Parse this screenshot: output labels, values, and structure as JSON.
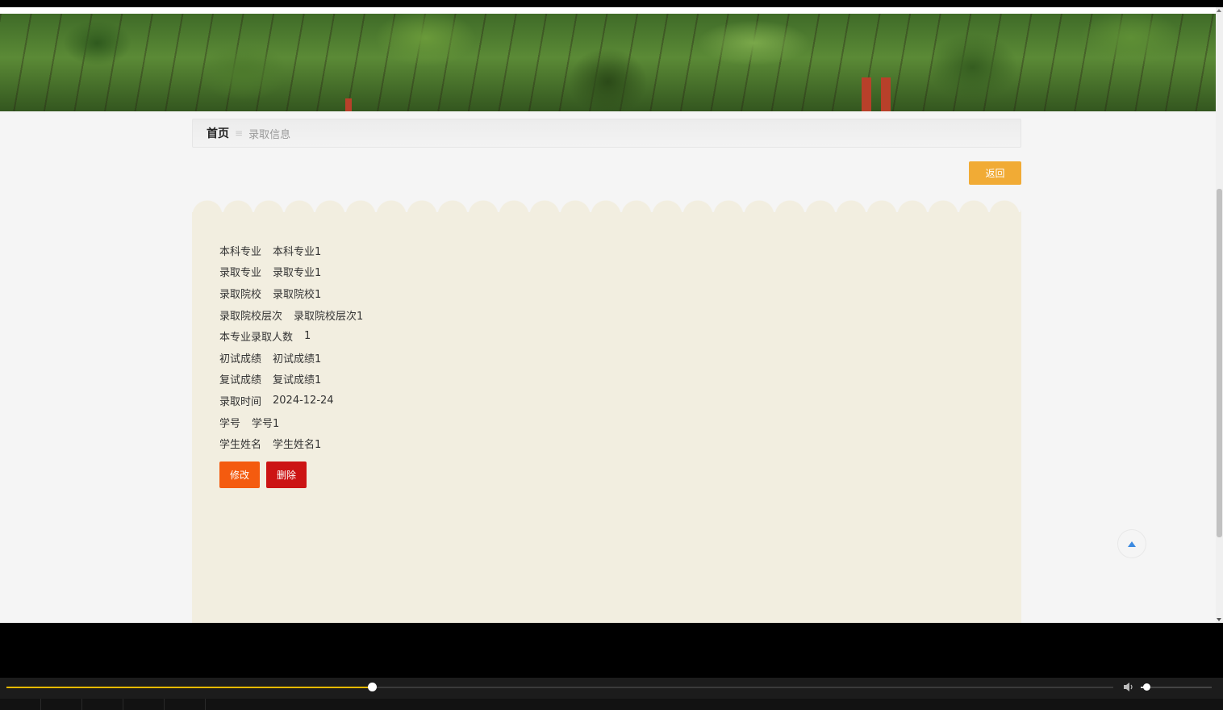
{
  "breadcrumb": {
    "home": "首页",
    "separator": "≡",
    "current": "录取信息"
  },
  "actions": {
    "back_label": "返回",
    "edit_label": "修改",
    "delete_label": "删除"
  },
  "details": [
    {
      "label": "本科专业",
      "value": "本科专业1"
    },
    {
      "label": "录取专业",
      "value": "录取专业1"
    },
    {
      "label": "录取院校",
      "value": "录取院校1"
    },
    {
      "label": "录取院校层次",
      "value": "录取院校层次1"
    },
    {
      "label": "本专业录取人数",
      "value": "1"
    },
    {
      "label": "初试成绩",
      "value": "初试成绩1"
    },
    {
      "label": "复试成绩",
      "value": "复试成绩1"
    },
    {
      "label": "录取时间",
      "value": "2024-12-24"
    },
    {
      "label": "学号",
      "value": "学号1"
    },
    {
      "label": "学生姓名",
      "value": "学生姓名1"
    }
  ],
  "player": {
    "progress_fraction": 0.33,
    "volume_fraction": 0.08
  },
  "colors": {
    "back": "#f1ab35",
    "edit": "#f45b0f",
    "delete": "#cc1414",
    "card": "#f2eee0",
    "seek": "#e5b800"
  },
  "icons": {
    "scroll_top": "triangle-up-icon",
    "volume": "speaker-icon"
  }
}
